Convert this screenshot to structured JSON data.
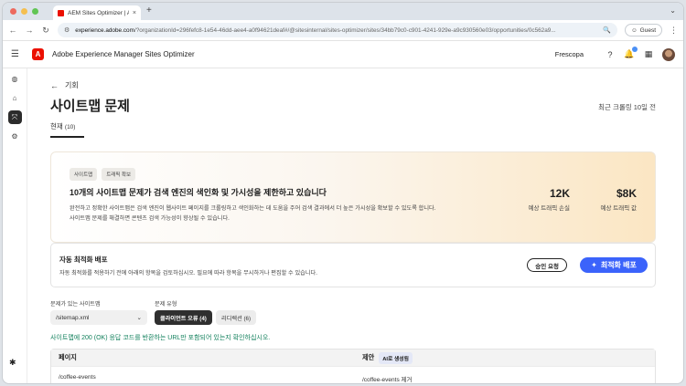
{
  "browser": {
    "tab_title": "AEM Sites Optimizer | Adobe",
    "tab_close": "×",
    "new_tab": "+",
    "url_domain": "experience.adobe.com",
    "url_path": "/?organizationId=296fefc8-1e54-46dd-aee4-a0f94621deaf#/@sitesinternal/sites-optimizer/sites/34bb79c0-c901-4241-929e-a9c930560e03/opportunities/0c562a9...",
    "profile_label": "Guest",
    "traffic_lights": [
      "#ed6a5e",
      "#f5bf4f",
      "#61c554"
    ]
  },
  "app": {
    "brand_letter": "A",
    "name": "Adobe Experience Manager Sites Optimizer",
    "org": "Frescopa",
    "accent": "#3b63fb",
    "brand_color": "#eb1000"
  },
  "page": {
    "back_label": "기회",
    "title": "사이트맵 문제",
    "last_crawl": "최근 크롤링 10일 전",
    "tab_current": "현재",
    "tab_count": "(10)"
  },
  "hero": {
    "chips": [
      "사이트맵",
      "트래픽 확보"
    ],
    "title": "10개의 사이트맵 문제가 검색 엔진의 색인화 및 가시성을 제한하고 있습니다",
    "desc_line1": "완전하고 정확한 사이트맵은 검색 엔진이 웹사이트 페이지를 크롤링하고 색인화하는 데 도움을 주어 검색 결과에서 더 높은 가시성을 확보할 수 있도록 합니다.",
    "desc_line2": "사이트맵 문제를 해결하면 콘텐츠 검색 가능성이 향상될 수 있습니다.",
    "metric1_value": "12K",
    "metric1_label": "예상 트래픽 손실",
    "metric2_value": "$8K",
    "metric2_label": "예상 트래픽 값"
  },
  "deploy": {
    "title": "자동 최적화 배포",
    "desc": "자동 최적화를 적용하기 전에 아래의 항목을 검토하십시오. 필요에 따라 항목을 무시하거나 편집할 수 있습니다.",
    "request_label": "승인 요청",
    "deploy_label": "최적화 배포"
  },
  "filters": {
    "sitemap_label": "문제가 있는 사이트맵",
    "sitemap_value": "/sitemap.xml",
    "type_label": "문제 유형",
    "types": [
      {
        "label": "클라이언트 오류 (4)",
        "selected": true
      },
      {
        "label": "리디렉션 (6)",
        "selected": false
      }
    ]
  },
  "info_text": "사이트맵에 200 (OK) 응답 코드를 반환하는 URL만 포함되어 있는지 확인하십시오.",
  "table": {
    "col_page": "페이지",
    "col_suggestion": "제안",
    "ai_badge": "AI로 생성됨",
    "rows": [
      {
        "page": "/coffee-events",
        "suggestion": "/coffee-events 제거"
      }
    ]
  }
}
